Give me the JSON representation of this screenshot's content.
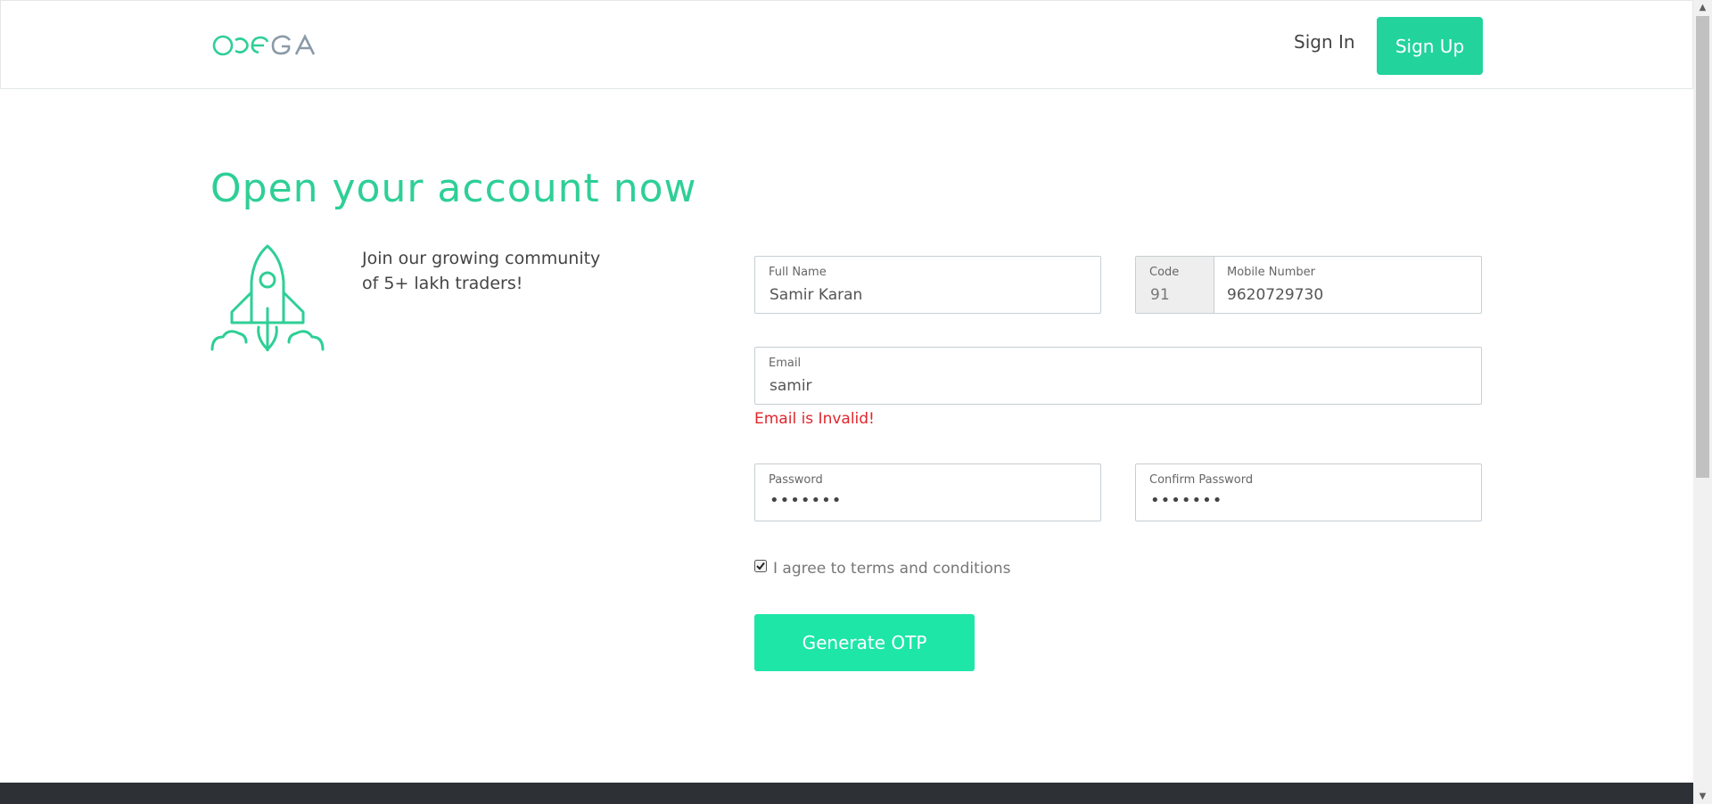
{
  "header": {
    "logo_text": "OMEGA",
    "sign_in": "Sign In",
    "sign_up": "Sign Up"
  },
  "hero": {
    "title": "Open your account now",
    "tagline_line1": "Join our growing community",
    "tagline_line2": "of 5+ lakh traders!"
  },
  "form": {
    "full_name": {
      "label": "Full Name",
      "value": "Samir Karan"
    },
    "code": {
      "label": "Code",
      "value": "91"
    },
    "mobile": {
      "label": "Mobile Number",
      "value": "9620729730"
    },
    "email": {
      "label": "Email",
      "value": "samir",
      "error": "Email is Invalid!"
    },
    "password": {
      "label": "Password",
      "value": "•••••••"
    },
    "confirm_password": {
      "label": "Confirm Password",
      "value": "•••••••"
    },
    "terms": {
      "label": "I agree to terms and conditions",
      "checked": true
    },
    "submit": "Generate OTP"
  },
  "colors": {
    "accent": "#23d39c",
    "button": "#1ee6a6",
    "error": "#e0262c",
    "footer": "#2d3135"
  }
}
